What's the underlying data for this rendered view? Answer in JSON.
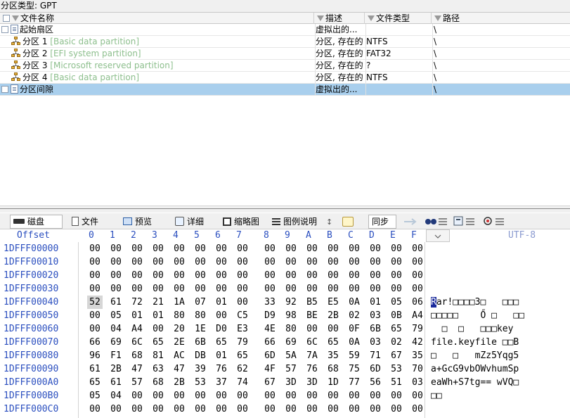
{
  "partition_type_label": "分区类型: GPT",
  "columns": {
    "name": "文件名称",
    "description": "描述",
    "file_type": "文件类型",
    "path": "路径"
  },
  "rows": [
    {
      "name": "起始扇区",
      "label": "",
      "description": "虚拟出的...",
      "file_type": "",
      "path": "\\",
      "icon": "doc-icon",
      "selected": false
    },
    {
      "name": "分区 1",
      "label": "[Basic data partition]",
      "description": "分区, 存在的",
      "file_type": "NTFS",
      "path": "\\",
      "icon": "partition-icon",
      "selected": false
    },
    {
      "name": "分区 2",
      "label": "[EFI system partition]",
      "description": "分区, 存在的",
      "file_type": "FAT32",
      "path": "\\",
      "icon": "partition-icon",
      "selected": false
    },
    {
      "name": "分区 3",
      "label": "[Microsoft reserved partition]",
      "description": "分区, 存在的",
      "file_type": "?",
      "path": "\\",
      "icon": "partition-icon",
      "selected": false
    },
    {
      "name": "分区 4",
      "label": "[Basic data partition]",
      "description": "分区, 存在的",
      "file_type": "NTFS",
      "path": "\\",
      "icon": "partition-icon",
      "selected": false
    },
    {
      "name": "分区间隙",
      "label": "",
      "description": "虚拟出的...",
      "file_type": "",
      "path": "\\",
      "icon": "doc-icon",
      "selected": true
    }
  ],
  "toolbar": {
    "disk": "磁盘",
    "file": "文件",
    "preview": "预览",
    "details": "详细",
    "thumbnails": "缩略图",
    "legend": "图例说明",
    "sync": "同步"
  },
  "hex_header": {
    "offset": "Offset",
    "columns": [
      "0",
      "1",
      "2",
      "3",
      "4",
      "5",
      "6",
      "7",
      "8",
      "9",
      "A",
      "B",
      "C",
      "D",
      "E",
      "F"
    ],
    "text_encoding": "UTF-8"
  },
  "hex_rows": [
    {
      "offset": "1DFFF00000",
      "bytes": [
        "00",
        "00",
        "00",
        "00",
        "00",
        "00",
        "00",
        "00",
        "00",
        "00",
        "00",
        "00",
        "00",
        "00",
        "00",
        "00"
      ],
      "text": ""
    },
    {
      "offset": "1DFFF00010",
      "bytes": [
        "00",
        "00",
        "00",
        "00",
        "00",
        "00",
        "00",
        "00",
        "00",
        "00",
        "00",
        "00",
        "00",
        "00",
        "00",
        "00"
      ],
      "text": ""
    },
    {
      "offset": "1DFFF00020",
      "bytes": [
        "00",
        "00",
        "00",
        "00",
        "00",
        "00",
        "00",
        "00",
        "00",
        "00",
        "00",
        "00",
        "00",
        "00",
        "00",
        "00"
      ],
      "text": ""
    },
    {
      "offset": "1DFFF00030",
      "bytes": [
        "00",
        "00",
        "00",
        "00",
        "00",
        "00",
        "00",
        "00",
        "00",
        "00",
        "00",
        "00",
        "00",
        "00",
        "00",
        "00"
      ],
      "text": ""
    },
    {
      "offset": "1DFFF00040",
      "bytes": [
        "52",
        "61",
        "72",
        "21",
        "1A",
        "07",
        "01",
        "00",
        "33",
        "92",
        "B5",
        "E5",
        "0A",
        "01",
        "05",
        "06"
      ],
      "text": "Rar!□□□□3□   □□□"
    },
    {
      "offset": "1DFFF00050",
      "bytes": [
        "00",
        "05",
        "01",
        "01",
        "80",
        "80",
        "00",
        "C5",
        "D9",
        "98",
        "BE",
        "2B",
        "02",
        "03",
        "0B",
        "A4"
      ],
      "text": "□□□□□    Ő □   □□"
    },
    {
      "offset": "1DFFF00060",
      "bytes": [
        "00",
        "04",
        "A4",
        "00",
        "20",
        "1E",
        "D0",
        "E3",
        "4E",
        "80",
        "00",
        "00",
        "0F",
        "6B",
        "65",
        "79"
      ],
      "text": "  □  □   □□□key"
    },
    {
      "offset": "1DFFF00070",
      "bytes": [
        "66",
        "69",
        "6C",
        "65",
        "2E",
        "6B",
        "65",
        "79",
        "66",
        "69",
        "6C",
        "65",
        "0A",
        "03",
        "02",
        "42"
      ],
      "text": "file.keyfile □□B"
    },
    {
      "offset": "1DFFF00080",
      "bytes": [
        "96",
        "F1",
        "68",
        "81",
        "AC",
        "DB",
        "01",
        "65",
        "6D",
        "5A",
        "7A",
        "35",
        "59",
        "71",
        "67",
        "35"
      ],
      "text": "□   □   mZz5Yqg5"
    },
    {
      "offset": "1DFFF00090",
      "bytes": [
        "61",
        "2B",
        "47",
        "63",
        "47",
        "39",
        "76",
        "62",
        "4F",
        "57",
        "76",
        "68",
        "75",
        "6D",
        "53",
        "70"
      ],
      "text": "a+GcG9vbOWvhumSp"
    },
    {
      "offset": "1DFFF000A0",
      "bytes": [
        "65",
        "61",
        "57",
        "68",
        "2B",
        "53",
        "37",
        "74",
        "67",
        "3D",
        "3D",
        "1D",
        "77",
        "56",
        "51",
        "03"
      ],
      "text": "eaWh+S7tg== wVQ□"
    },
    {
      "offset": "1DFFF000B0",
      "bytes": [
        "05",
        "04",
        "00",
        "00",
        "00",
        "00",
        "00",
        "00",
        "00",
        "00",
        "00",
        "00",
        "00",
        "00",
        "00",
        "00"
      ],
      "text": "□□"
    },
    {
      "offset": "1DFFF000C0",
      "bytes": [
        "00",
        "00",
        "00",
        "00",
        "00",
        "00",
        "00",
        "00",
        "00",
        "00",
        "00",
        "00",
        "00",
        "00",
        "00",
        "00"
      ],
      "text": ""
    }
  ],
  "colors": {
    "selected_row": "#a9cfed",
    "offset_blue": "#2b4fbf",
    "partition_label_green": "#8dbf8d"
  }
}
